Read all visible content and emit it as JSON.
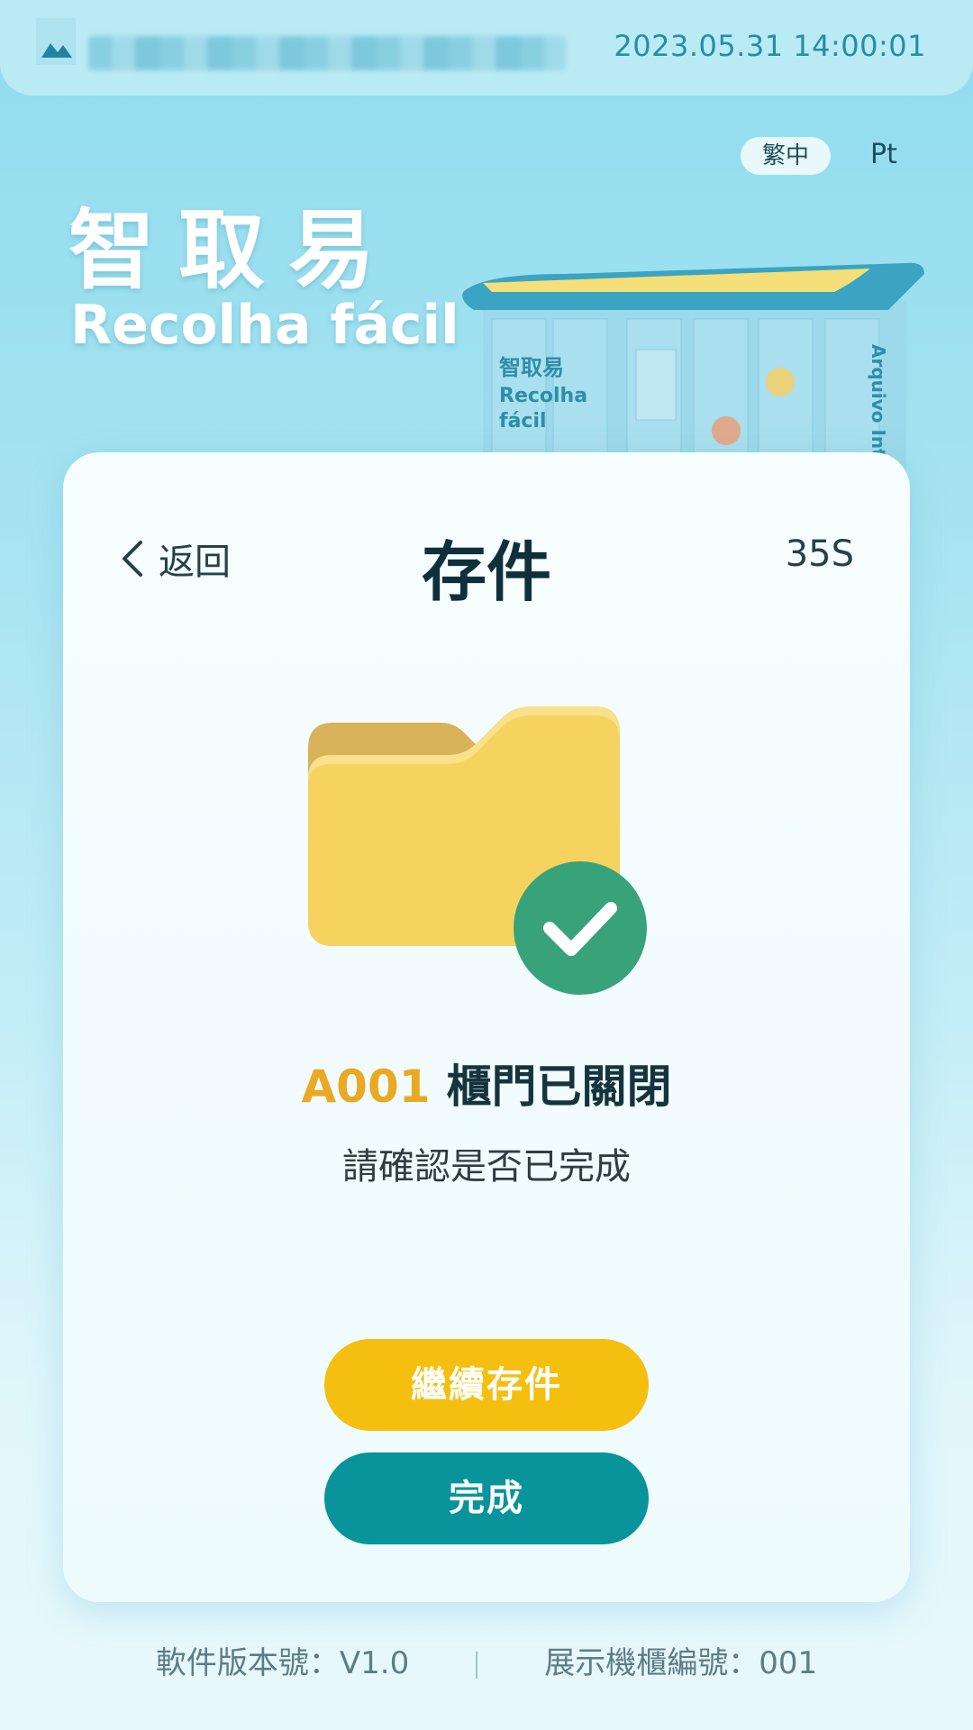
{
  "header": {
    "datetime": "2023.05.31 14:00:01"
  },
  "language": {
    "current": "繁中",
    "alternate": "Pt"
  },
  "brand": {
    "name_cn": "智取易",
    "name_pt": "Recolha fácil",
    "cabinet_name_cn": "智取易",
    "cabinet_name_pt_1": "Recolha",
    "cabinet_name_pt_2": "fácil",
    "cabinet_side_text": "Arquivo Inte"
  },
  "card": {
    "back_label": "返回",
    "title": "存件",
    "countdown": "35S",
    "status_code": "A001",
    "status_text": "櫃門已關閉",
    "sub_text": "請確認是否已完成",
    "continue_button": "繼續存件",
    "done_button": "完成"
  },
  "footer": {
    "software_version": "軟件版本號：V1.0",
    "cabinet_number": "展示機櫃編號：001"
  },
  "colors": {
    "accent_yellow": "#f5bf10",
    "accent_teal": "#09939a",
    "success_green": "#38a27a",
    "folder_yellow": "#f6d35f"
  },
  "icons": [
    "logo-icon",
    "chevron-left-icon",
    "folder-icon",
    "check-circle-icon"
  ]
}
